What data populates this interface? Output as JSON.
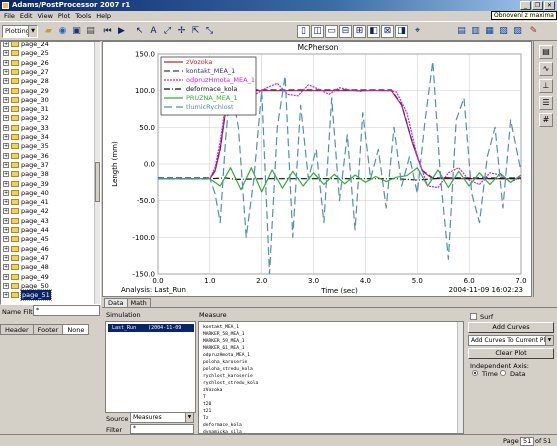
{
  "window": {
    "title": "Adams/PostProcessor 2007 r1",
    "tooltip": "Obnovení z maxima"
  },
  "menu": [
    "File",
    "Edit",
    "View",
    "Plot",
    "Tools",
    "Help"
  ],
  "toolbar": {
    "mode": "Plotting"
  },
  "tree": {
    "pages": [
      "page_24",
      "page_25",
      "page_26",
      "page_27",
      "page_28",
      "page_29",
      "page_30",
      "page_31",
      "page_32",
      "page_33",
      "page_34",
      "page_35",
      "page_36",
      "page_37",
      "page_38",
      "page_39",
      "page_40",
      "page_41",
      "page_42",
      "page_43",
      "page_44",
      "page_45",
      "page_46",
      "page_47",
      "page_48",
      "page_49",
      "page_50",
      "page_51"
    ],
    "selected": "page_51"
  },
  "name_filter": {
    "label": "Name Filter",
    "value": "*"
  },
  "left_tabs": [
    "Header",
    "Footer",
    "None"
  ],
  "plot": {
    "title": "McPherson",
    "analysis": "Analysis:  Last_Run",
    "timestamp": "2004-11-09 16:02:23"
  },
  "chart_data": {
    "type": "line",
    "title": "McPherson",
    "xlabel": "Time (sec)",
    "ylabel": "Length (mm)",
    "xlim": [
      0.0,
      7.0
    ],
    "ylim": [
      -150.0,
      150.0
    ],
    "xticks": [
      "0.0",
      "1.0",
      "2.0",
      "3.0",
      "4.0",
      "5.0",
      "6.0",
      "7.0"
    ],
    "yticks": [
      "150.0",
      "100.0",
      "50.0",
      "0.0",
      "-50.0",
      "-100.0",
      "-150.0"
    ],
    "grid": true,
    "legend": "top-left",
    "series": [
      {
        "name": "zVozoka",
        "color": "#d02020",
        "dash": "solid",
        "x": [
          0.0,
          1.0,
          1.1,
          1.2,
          1.3,
          1.4,
          1.6,
          2.0,
          3.0,
          4.0,
          4.5,
          4.7,
          4.9,
          5.1,
          5.3,
          5.6,
          6.0,
          7.0
        ],
        "y": [
          -20,
          -20,
          -10,
          20,
          70,
          95,
          100,
          100,
          100,
          100,
          100,
          80,
          30,
          -10,
          -20,
          -20,
          -20,
          -20
        ]
      },
      {
        "name": "kontakt_MEA_1",
        "color": "#3030b0",
        "dash": "6,3",
        "x": [
          0.0,
          1.0,
          1.1,
          1.2,
          1.3,
          1.4,
          1.6,
          2.0,
          3.0,
          4.0,
          4.5,
          4.7,
          4.9,
          5.1,
          5.3,
          5.6,
          6.0,
          7.0
        ],
        "y": [
          -19,
          -19,
          -9,
          21,
          71,
          96,
          101,
          101,
          101,
          101,
          101,
          81,
          31,
          -9,
          -19,
          -19,
          -19,
          -19
        ]
      },
      {
        "name": "odpruzHmota_MEA_1",
        "color": "#d020d0",
        "dash": "2,1",
        "x": [
          0.0,
          1.0,
          1.1,
          1.2,
          1.3,
          1.4,
          1.5,
          1.7,
          1.9,
          2.1,
          2.3,
          2.5,
          2.7,
          2.9,
          3.1,
          3.3,
          3.5,
          3.7,
          3.9,
          4.1,
          4.3,
          4.5,
          4.6,
          4.8,
          5.0,
          5.2,
          5.4,
          5.6,
          5.8,
          6.0,
          6.2,
          6.4,
          6.6,
          6.8,
          7.0
        ],
        "y": [
          -20,
          -20,
          -5,
          30,
          80,
          105,
          112,
          106,
          96,
          104,
          110,
          95,
          93,
          108,
          102,
          95,
          104,
          101,
          99,
          101,
          100,
          100,
          98,
          70,
          10,
          -30,
          -32,
          -12,
          -5,
          -22,
          -28,
          -12,
          -15,
          -25,
          -17
        ]
      },
      {
        "name": "deformace_kola",
        "color": "#101010",
        "dash": "6,2,1,2",
        "x": [
          0.0,
          1.0,
          1.3,
          1.5,
          2.0,
          3.0,
          4.0,
          4.6,
          5.0,
          5.5,
          6.0,
          7.0
        ],
        "y": [
          -20,
          -20,
          -19,
          -21,
          -20,
          -20,
          -20,
          -20,
          -22,
          -19,
          -20,
          -20
        ]
      },
      {
        "name": "PRUZNA_MEA_1",
        "color": "#30b030",
        "dash": "solid",
        "x": [
          0.0,
          1.0,
          1.2,
          1.4,
          1.6,
          1.8,
          2.0,
          2.2,
          2.4,
          2.6,
          2.8,
          3.0,
          3.2,
          3.4,
          3.6,
          3.8,
          4.0,
          4.2,
          4.4,
          4.6,
          4.8,
          5.0,
          5.2,
          5.4,
          5.6,
          5.8,
          6.0,
          6.2,
          6.4,
          6.6,
          6.8,
          7.0
        ],
        "y": [
          -20,
          -20,
          -30,
          -5,
          -35,
          -5,
          -38,
          -8,
          -33,
          -10,
          -30,
          -12,
          -28,
          -14,
          -27,
          -15,
          -25,
          -17,
          -24,
          -18,
          -16,
          -5,
          -30,
          -8,
          -32,
          -10,
          -30,
          -12,
          -28,
          -13,
          -25,
          -15
        ]
      },
      {
        "name": "tlumicRychlost",
        "color": "#5090b0",
        "dash": "8,4",
        "x": [
          0.0,
          1.0,
          1.1,
          1.2,
          1.3,
          1.4,
          1.55,
          1.7,
          1.85,
          2.0,
          2.15,
          2.3,
          2.45,
          2.6,
          2.75,
          2.9,
          3.05,
          3.2,
          3.35,
          3.5,
          3.65,
          3.8,
          3.95,
          4.1,
          4.25,
          4.4,
          4.55,
          4.7,
          4.85,
          5.0,
          5.15,
          5.3,
          5.45,
          5.6,
          5.75,
          5.9,
          6.05,
          6.2,
          6.35,
          6.5,
          6.65,
          6.8,
          7.0
        ],
        "y": [
          -20,
          -20,
          -40,
          -80,
          30,
          110,
          50,
          -100,
          -20,
          100,
          -170,
          50,
          120,
          -100,
          80,
          -20,
          20,
          -80,
          90,
          -50,
          40,
          -90,
          70,
          -20,
          20,
          -60,
          50,
          -30,
          10,
          -40,
          60,
          140,
          -20,
          -130,
          60,
          90,
          -40,
          -80,
          10,
          50,
          -60,
          60,
          -10
        ]
      }
    ]
  },
  "data_tabs": [
    "Data",
    "Math"
  ],
  "simulation": {
    "label": "Simulation",
    "items": [
      {
        "name": "Last_Run",
        "date": "(2004-11-09"
      }
    ]
  },
  "measure": {
    "label": "Measure",
    "items": [
      "kontakt_MEA_1",
      "MARKER_58_MEA_1",
      "MARKER_59_MEA_1",
      "MARKER_61_MEA_1",
      "odpruzHmota_MEA_1",
      "poloha_karoserie",
      "poloha_stredu_kola",
      "rychlost_karoserie",
      "rychlost_stredu_kola",
      "zVozoka",
      "T",
      "t20",
      "t21",
      "Tz",
      "deformace_kola",
      "dynamicka_sila"
    ]
  },
  "source": {
    "label": "Source",
    "value": "Measures"
  },
  "filter": {
    "label": "Filter",
    "value": "*"
  },
  "options": {
    "surf_label": "Surf",
    "add_curves": "Add Curves",
    "add_mode": "Add Curves To Current Plot",
    "clear_plot": "Clear Plot",
    "independent_axis": "Independent Axis:",
    "time_label": "Time",
    "data_label": "Data"
  },
  "status": {
    "page_label": "Page",
    "page_value": "51",
    "of_label": "of",
    "total_value": "51"
  }
}
